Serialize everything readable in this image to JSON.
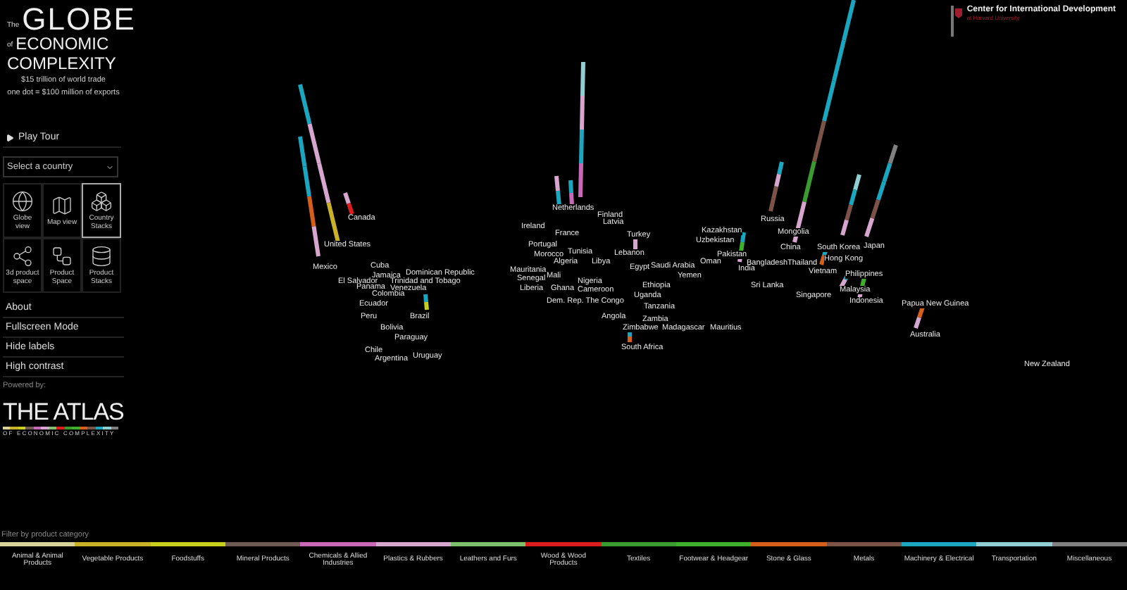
{
  "title": {
    "prefix": "The",
    "main": "GLOBE",
    "connector": "of",
    "line2": "ECONOMIC",
    "line3": "COMPLEXITY"
  },
  "subtitle": [
    "$15 trillion of world trade",
    "one dot = $100 million of exports"
  ],
  "play_tour": {
    "label": "Play Tour"
  },
  "country_select": {
    "placeholder": "Select a country"
  },
  "views": [
    {
      "label": "Globe view",
      "selected": false
    },
    {
      "label": "Map view",
      "selected": false
    },
    {
      "label": "Country Stacks",
      "selected": true
    },
    {
      "label": "3d product space",
      "selected": false
    },
    {
      "label": "Product Space",
      "selected": false
    },
    {
      "label": "Product Stacks",
      "selected": false
    }
  ],
  "menu": [
    "About",
    "Fullscreen Mode",
    "Hide labels",
    "High contrast"
  ],
  "powered_by": "Powered by:",
  "atlas_logo": {
    "title": "THE ATLAS",
    "subtitle": "OF ECONOMIC COMPLEXITY"
  },
  "partner_logo": {
    "title": "Center for International Development",
    "subtitle": "at Harvard University"
  },
  "map": {
    "labels": [
      "Canada",
      "United States",
      "Mexico",
      "Cuba",
      "Jamaica",
      "Dominican Republic",
      "El Salvador",
      "Panama",
      "Trinidad and Tobago",
      "Venezuela",
      "Colombia",
      "Ecuador",
      "Peru",
      "Brazil",
      "Bolivia",
      "Paraguay",
      "Chile",
      "Argentina",
      "Uruguay",
      "Ireland",
      "Netherlands",
      "Finland",
      "Latvia",
      "France",
      "Turkey",
      "Portugal",
      "Morocco",
      "Tunisia",
      "Algeria",
      "Libya",
      "Lebanon",
      "Egypt",
      "Saudi Arabia",
      "Oman",
      "Yemen",
      "Mauritania",
      "Mali",
      "Senegal",
      "Liberia",
      "Ghana",
      "Nigeria",
      "Cameroon",
      "Dem. Rep. The Congo",
      "Ethiopia",
      "Uganda",
      "Tanzania",
      "Angola",
      "Zambia",
      "Zimbabwe",
      "Madagascar",
      "Mauritius",
      "South Africa",
      "Russia",
      "Kazakhstan",
      "Mongolia",
      "Uzbekistan",
      "China",
      "South Korea",
      "Japan",
      "Pakistan",
      "Hong Kong",
      "Bangladesh",
      "Thailand",
      "India",
      "Vietnam",
      "Philippines",
      "Sri Lanka",
      "Malaysia",
      "Singapore",
      "Indonesia",
      "Papua New Guinea",
      "Australia",
      "New Zealand"
    ]
  },
  "legend": {
    "title": "Filter by product category",
    "categories": [
      {
        "label": "Animal & Animal Products",
        "color": "#d8d39a"
      },
      {
        "label": "Vegetable Products",
        "color": "#c9b227"
      },
      {
        "label": "Foodstuffs",
        "color": "#c7cf1c"
      },
      {
        "label": "Mineral Products",
        "color": "#6f5a54"
      },
      {
        "label": "Chemicals & Allied Industries",
        "color": "#c769b7"
      },
      {
        "label": "Plastics & Rubbers",
        "color": "#d7a6cf"
      },
      {
        "label": "Leathers and Furs",
        "color": "#7dc06c"
      },
      {
        "label": "Wood & Wood Products",
        "color": "#dd1d1d"
      },
      {
        "label": "Textiles",
        "color": "#3a9b31"
      },
      {
        "label": "Footwear & Headgear",
        "color": "#3eb02b"
      },
      {
        "label": "Stone & Glass",
        "color": "#d55e1a"
      },
      {
        "label": "Metals",
        "color": "#7b5447"
      },
      {
        "label": "Machinery & Electrical",
        "color": "#1ba6c0"
      },
      {
        "label": "Transportation",
        "color": "#8fcfd3"
      },
      {
        "label": "Miscellaneous",
        "color": "#808080"
      }
    ]
  }
}
